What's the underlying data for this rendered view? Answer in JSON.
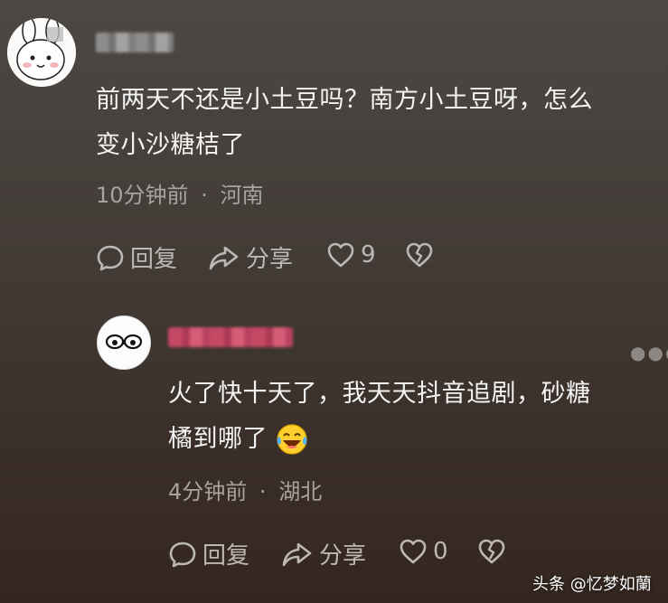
{
  "comments": [
    {
      "text_line1": "前两天不还是小土豆吗？南方小土豆呀，怎么",
      "text_line2": "变小沙糖桔了",
      "time": "10分钟前",
      "location": "河南",
      "actions": {
        "reply": "回复",
        "share": "分享",
        "likes": "9"
      }
    },
    {
      "text_line1": "火了快十天了，我天天抖音追剧，砂糖",
      "text_line2": "橘到哪了",
      "emoji_icon": "laughing-crying-face-icon",
      "time": "4分钟前",
      "location": "湖北",
      "actions": {
        "reply": "回复",
        "share": "分享",
        "likes": "0"
      }
    }
  ],
  "separator": "·",
  "more_icon": "more-dots-icon",
  "watermark": "头条 @忆梦如蘭",
  "colors": {
    "accent_name": "#d44a6a",
    "meta": "#a8a39e",
    "action": "#bdb8b3"
  }
}
